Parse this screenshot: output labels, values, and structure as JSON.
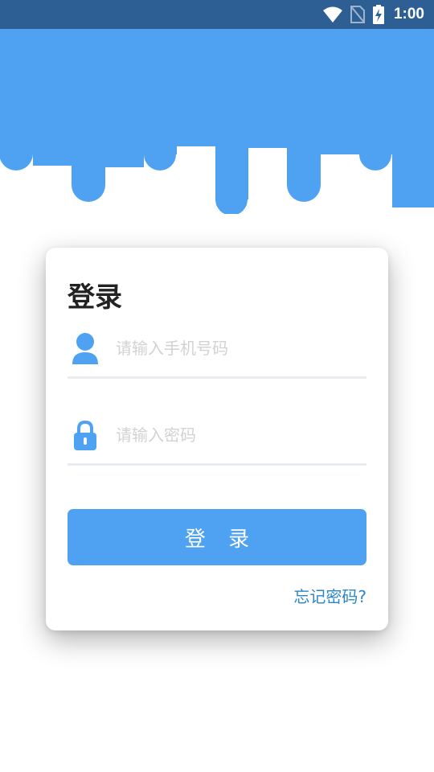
{
  "status_bar": {
    "time": "1:00",
    "icons": [
      "wifi-icon",
      "no-sim-icon",
      "battery-charging-icon"
    ]
  },
  "colors": {
    "status_bar": "#2e5f94",
    "accent": "#4fa2f2",
    "link": "#2b86c9"
  },
  "login": {
    "title": "登录",
    "phone": {
      "icon": "user-icon",
      "placeholder": "请输入手机号码",
      "value": ""
    },
    "password": {
      "icon": "lock-icon",
      "placeholder": "请输入密码",
      "value": ""
    },
    "submit_label": "登 录",
    "forgot_label": "忘记密码?"
  }
}
